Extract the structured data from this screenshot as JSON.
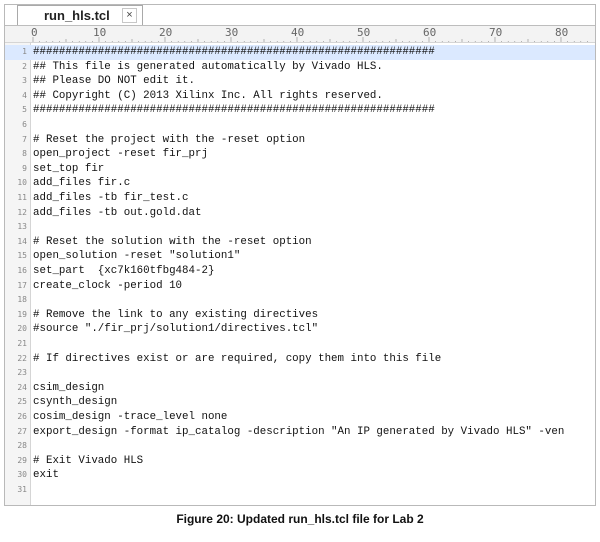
{
  "tab": {
    "title": "run_hls.tcl",
    "close_glyph": "×"
  },
  "ruler": {
    "labels": [
      "0",
      "10",
      "20",
      "30",
      "40",
      "50",
      "60",
      "70",
      "80"
    ]
  },
  "editor": {
    "lines": [
      {
        "n": "1",
        "text": "##############################################################"
      },
      {
        "n": "2",
        "text": "## This file is generated automatically by Vivado HLS."
      },
      {
        "n": "3",
        "text": "## Please DO NOT edit it."
      },
      {
        "n": "4",
        "text": "## Copyright (C) 2013 Xilinx Inc. All rights reserved."
      },
      {
        "n": "5",
        "text": "##############################################################"
      },
      {
        "n": "6",
        "text": ""
      },
      {
        "n": "7",
        "text": "# Reset the project with the -reset option"
      },
      {
        "n": "8",
        "text": "open_project -reset fir_prj"
      },
      {
        "n": "9",
        "text": "set_top fir"
      },
      {
        "n": "10",
        "text": "add_files fir.c"
      },
      {
        "n": "11",
        "text": "add_files -tb fir_test.c"
      },
      {
        "n": "12",
        "text": "add_files -tb out.gold.dat"
      },
      {
        "n": "13",
        "text": ""
      },
      {
        "n": "14",
        "text": "# Reset the solution with the -reset option"
      },
      {
        "n": "15",
        "text": "open_solution -reset \"solution1\""
      },
      {
        "n": "16",
        "text": "set_part  {xc7k160tfbg484-2}"
      },
      {
        "n": "17",
        "text": "create_clock -period 10"
      },
      {
        "n": "18",
        "text": ""
      },
      {
        "n": "19",
        "text": "# Remove the link to any existing directives"
      },
      {
        "n": "20",
        "text": "#source \"./fir_prj/solution1/directives.tcl\""
      },
      {
        "n": "21",
        "text": ""
      },
      {
        "n": "22",
        "text": "# If directives exist or are required, copy them into this file"
      },
      {
        "n": "23",
        "text": ""
      },
      {
        "n": "24",
        "text": "csim_design"
      },
      {
        "n": "25",
        "text": "csynth_design"
      },
      {
        "n": "26",
        "text": "cosim_design -trace_level none"
      },
      {
        "n": "27",
        "text": "export_design -format ip_catalog -description \"An IP generated by Vivado HLS\" -ven"
      },
      {
        "n": "28",
        "text": ""
      },
      {
        "n": "29",
        "text": "# Exit Vivado HLS"
      },
      {
        "n": "30",
        "text": "exit"
      },
      {
        "n": "31",
        "text": ""
      }
    ]
  },
  "caption": {
    "text": "Figure 20: Updated run_hls.tcl file for Lab 2"
  }
}
